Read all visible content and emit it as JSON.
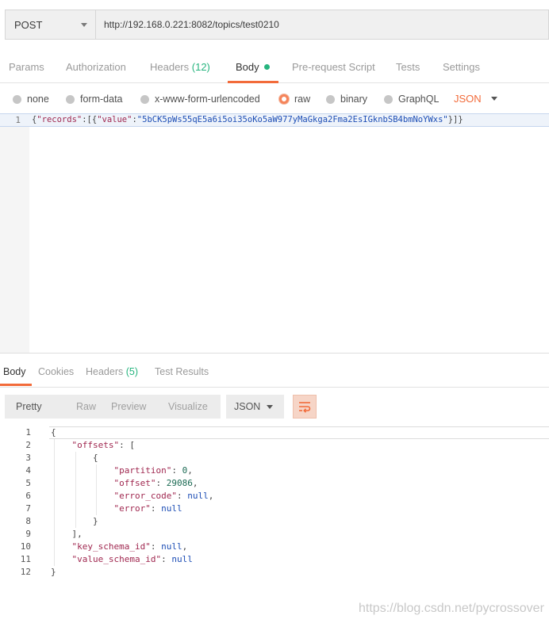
{
  "request": {
    "method": "POST",
    "url": "http://192.168.0.221:8082/topics/test0210"
  },
  "request_tabs": [
    {
      "label": "Params"
    },
    {
      "label": "Authorization"
    },
    {
      "label": "Headers",
      "count": "(12)"
    },
    {
      "label": "Body"
    },
    {
      "label": "Pre-request Script"
    },
    {
      "label": "Tests"
    },
    {
      "label": "Settings"
    }
  ],
  "body_options": [
    "none",
    "form-data",
    "x-www-form-urlencoded",
    "raw",
    "binary",
    "GraphQL"
  ],
  "body_format": "JSON",
  "editor": {
    "line_number": "1",
    "key": "\"records\"",
    "value_key": "\"value\"",
    "value": "\"5bCK5pWs55qE5a6i5oi35oKo5aW977yMaGkga2Fma2EsIGknbSB4bmNoYWxs\""
  },
  "response_tabs": [
    {
      "label": "Body"
    },
    {
      "label": "Cookies"
    },
    {
      "label": "Headers",
      "count": "(5)"
    },
    {
      "label": "Test Results"
    }
  ],
  "view_modes": [
    "Pretty",
    "Raw",
    "Preview",
    "Visualize"
  ],
  "response_format": "JSON",
  "response_lines": [
    "1",
    "2",
    "3",
    "4",
    "5",
    "6",
    "7",
    "8",
    "9",
    "10",
    "11",
    "12"
  ],
  "response_json": {
    "offsets_key": "\"offsets\"",
    "partition_key": "\"partition\"",
    "partition": "0",
    "offset_key": "\"offset\"",
    "offset": "29086",
    "error_code_key": "\"error_code\"",
    "error_key": "\"error\"",
    "key_schema_key": "\"key_schema_id\"",
    "value_schema_key": "\"value_schema_id\"",
    "null": "null"
  },
  "watermark": "https://blog.csdn.net/pycrossover",
  "colors": {
    "accent": "#f26b3a",
    "count": "#26b47e"
  }
}
